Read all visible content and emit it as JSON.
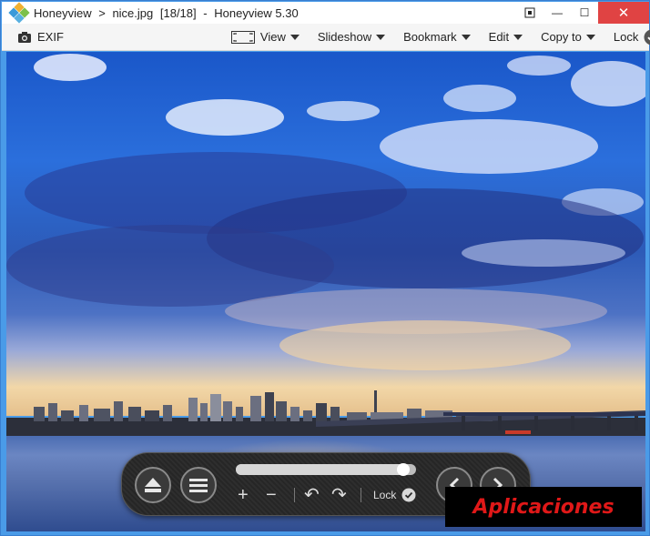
{
  "titlebar": {
    "app": "Honeyview",
    "separator": ">",
    "filename": "nice.jpg",
    "position": "[18/18]",
    "dash": "-",
    "app_version": "Honeyview 5.30"
  },
  "window_controls": {
    "screen_icon": "fit-screen-icon",
    "minimize": "—",
    "maximize": "☐",
    "close": "✕"
  },
  "toolbar": {
    "exif_label": "EXIF",
    "view_label": "View",
    "slideshow_label": "Slideshow",
    "bookmark_label": "Bookmark",
    "edit_label": "Edit",
    "copyto_label": "Copy to",
    "lock_label": "Lock"
  },
  "controls": {
    "eject_icon": "eject-icon",
    "menu_icon": "menu-icon",
    "zoom_in": "+",
    "zoom_out": "−",
    "rotate_left": "↶",
    "rotate_right": "↷",
    "lock_label": "Lock",
    "prev_icon": "chevron-left-icon",
    "next_icon": "chevron-right-icon",
    "progress": 0.96
  },
  "watermark": {
    "text": "Aplicaciones"
  },
  "colors": {
    "accent": "#4a9be8",
    "close": "#e04343",
    "watermark_text": "#e01818"
  }
}
